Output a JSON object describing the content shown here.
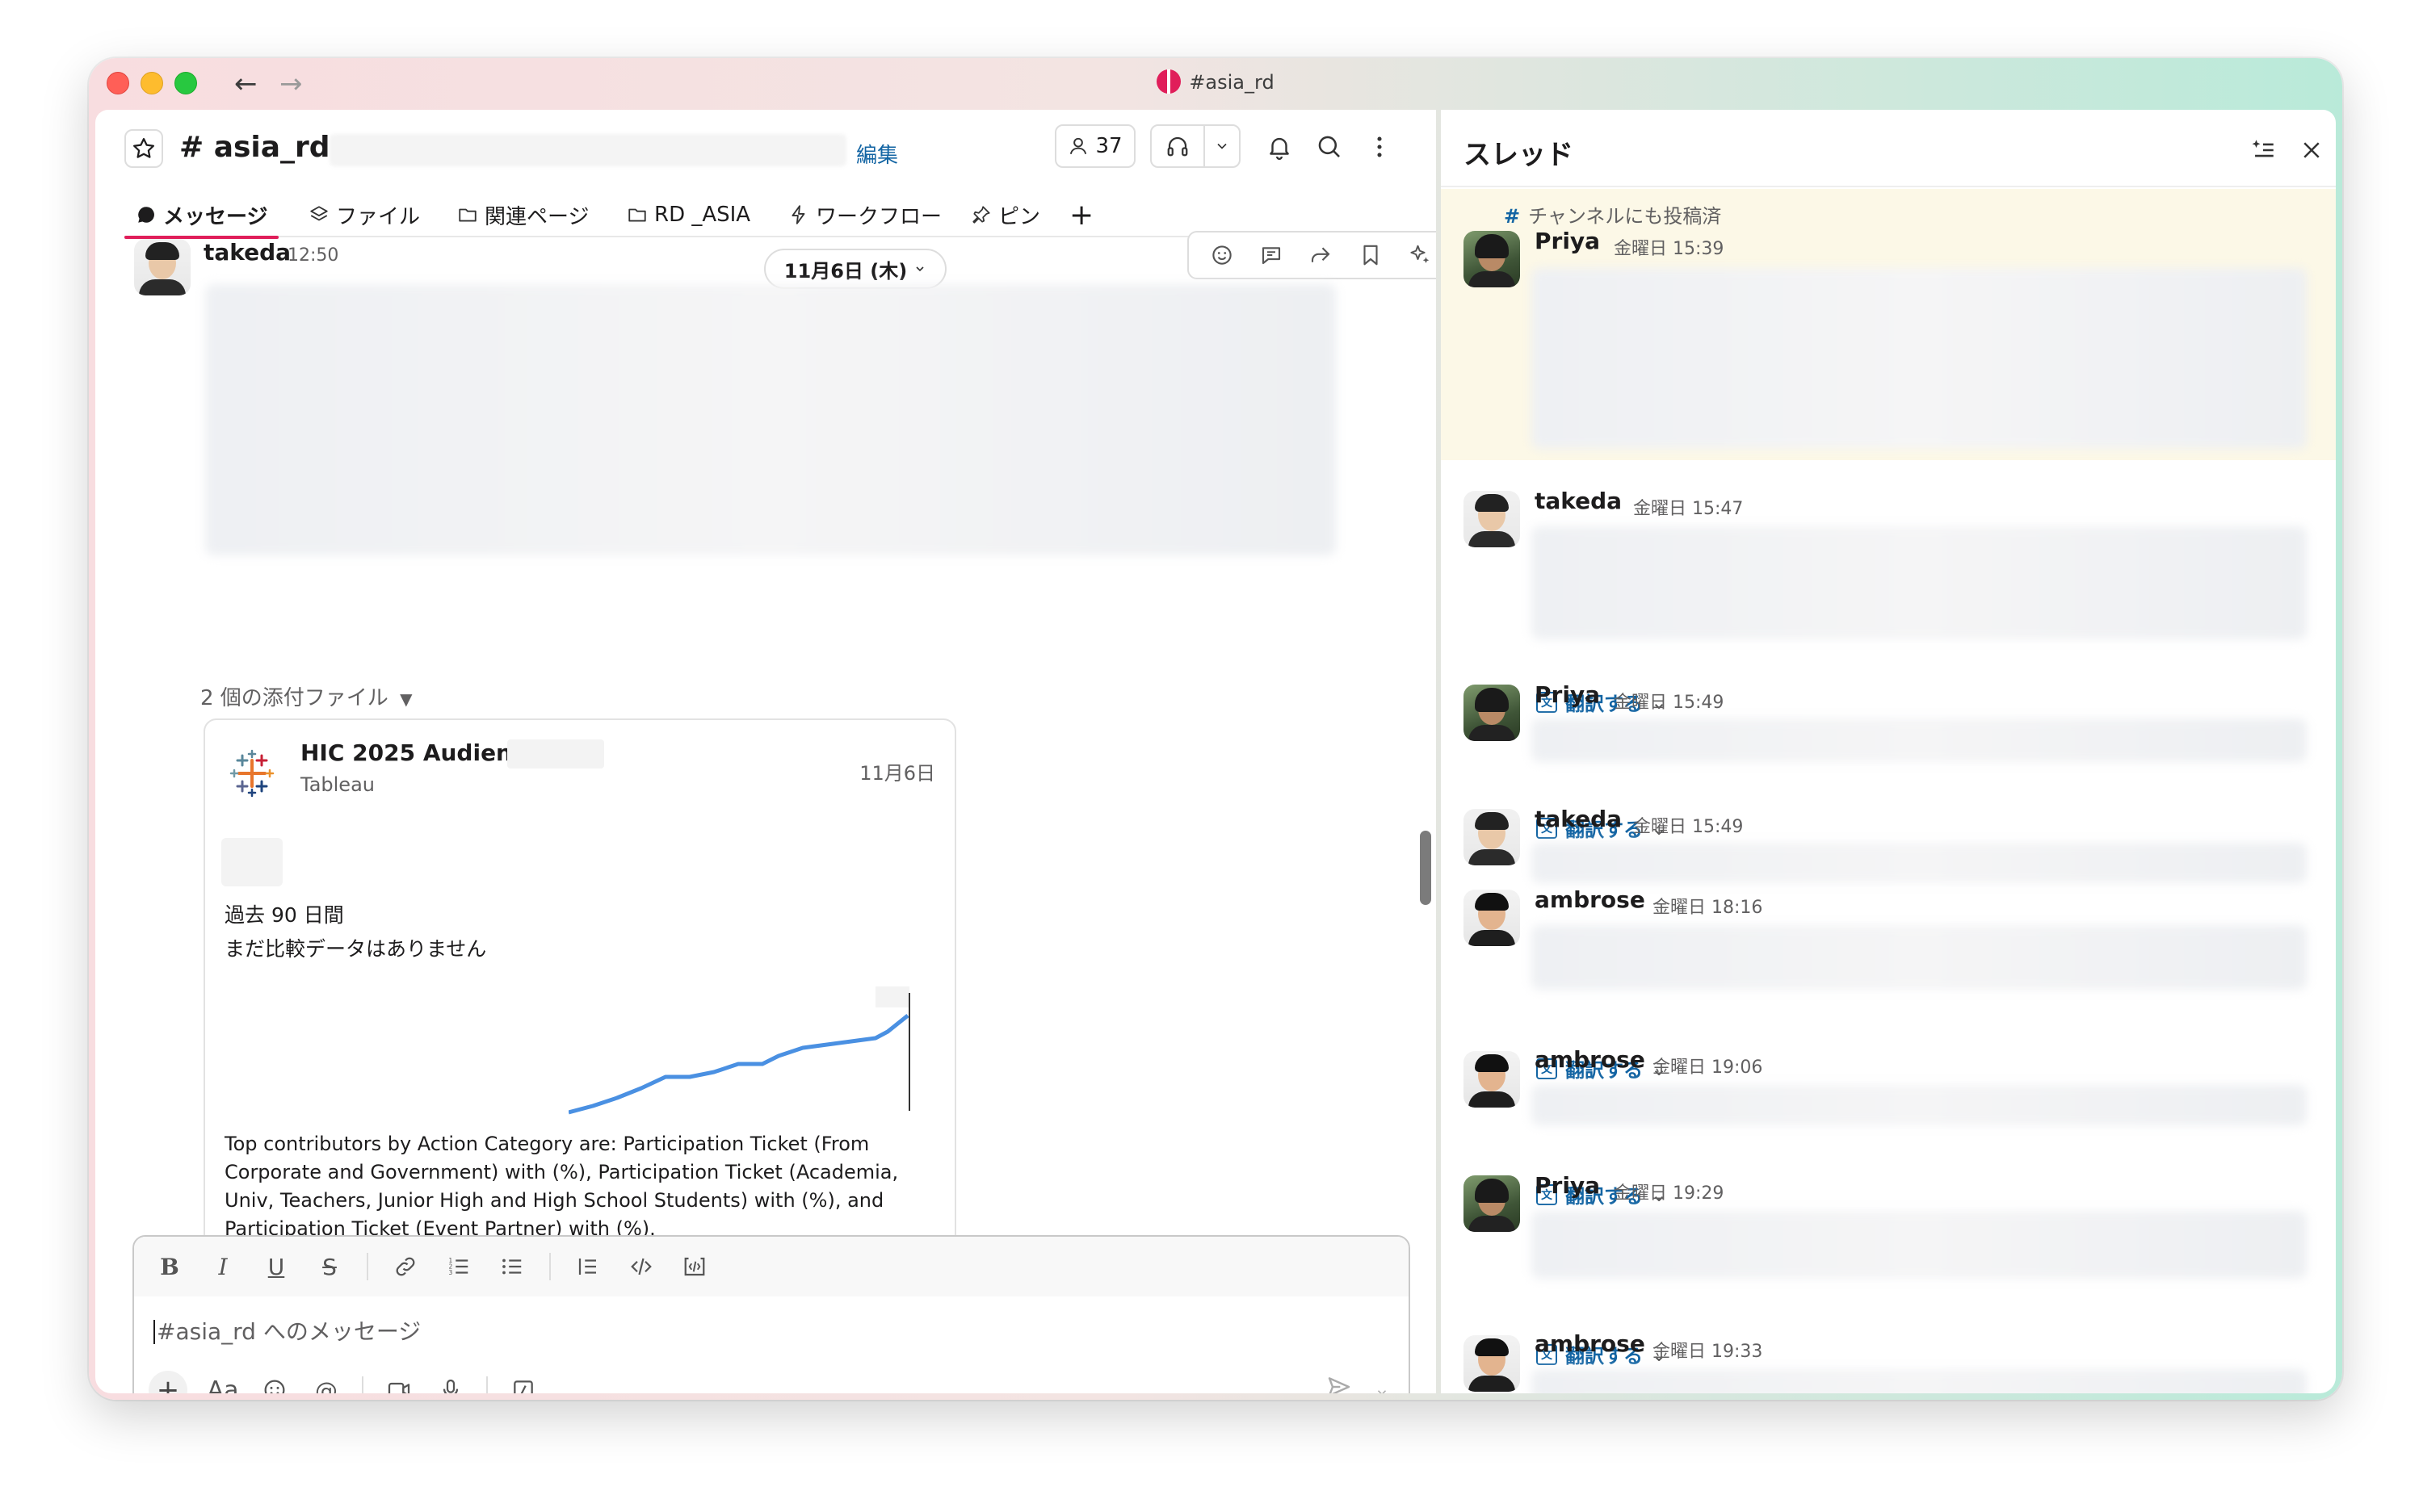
{
  "window": {
    "title": "#asia_rd"
  },
  "channel": {
    "name": "# asia_rd",
    "edit_label": "編集",
    "member_count": "37",
    "tabs": [
      {
        "label": "メッセージ"
      },
      {
        "label": "ファイル"
      },
      {
        "label": "関連ページ"
      },
      {
        "label": "RD _ASIA"
      },
      {
        "label": "ワークフロー"
      },
      {
        "label": "ピン"
      }
    ]
  },
  "message": {
    "sender": "takeda",
    "time": "12:50",
    "date_pill": "11月6日 (木)",
    "attachments_label": "2 個の添付ファイル",
    "card": {
      "title": "HIC 2025 Audience",
      "source": "Tableau",
      "date": "11月6日",
      "period": "過去 90 日間",
      "no_comparison": "まだ比較データはありません",
      "description": "Top contributors by Action Category are: Participation Ticket (From Corporate and Government) with (%), Participation Ticket (Academia, Univ, Teachers, Junior High and High School Students) with (%), and Participation Ticket (Event Partner) with (%)."
    }
  },
  "composer": {
    "placeholder": "#asia_rd へのメッセージ"
  },
  "thread": {
    "title": "スレッド",
    "also_posted": "チャンネルにも投稿済",
    "translate_label": "翻訳する",
    "replies": [
      {
        "sender": "Priya",
        "time": "金曜日 15:39"
      },
      {
        "sender": "takeda",
        "time": "金曜日 15:47"
      },
      {
        "sender": "Priya",
        "time": "金曜日 15:49"
      },
      {
        "sender": "takeda",
        "time": "金曜日 15:49"
      },
      {
        "sender": "ambrose",
        "time": "金曜日 18:16"
      },
      {
        "sender": "ambrose",
        "time": "金曜日 19:06"
      },
      {
        "sender": "Priya",
        "time": "金曜日 19:29"
      },
      {
        "sender": "ambrose",
        "time": "金曜日 19:33"
      }
    ]
  },
  "colors": {
    "accent": "#e01e5a",
    "link": "#1264a3",
    "highlight": "#fcf8e7"
  }
}
